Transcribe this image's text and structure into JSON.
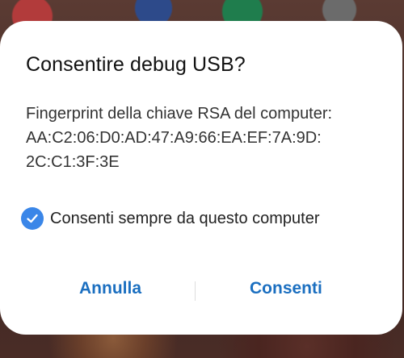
{
  "dialog": {
    "title": "Consentire debug USB?",
    "message_lines": [
      "Fingerprint della chiave RSA del computer:",
      "AA:C2:06:D0:AD:47:A9:66:EA:EF:7A:9D:",
      "2C:C1:3F:3E"
    ],
    "checkbox": {
      "label": "Consenti sempre da questo computer",
      "checked": true,
      "icon": "check-circle-icon"
    },
    "buttons": {
      "cancel_label": "Annulla",
      "allow_label": "Consenti"
    }
  },
  "colors": {
    "accent": "#1b6fc0",
    "checkbox": "#3a86e8",
    "dialog_bg": "#ffffff",
    "title_text": "#111111",
    "body_text": "#333333"
  }
}
